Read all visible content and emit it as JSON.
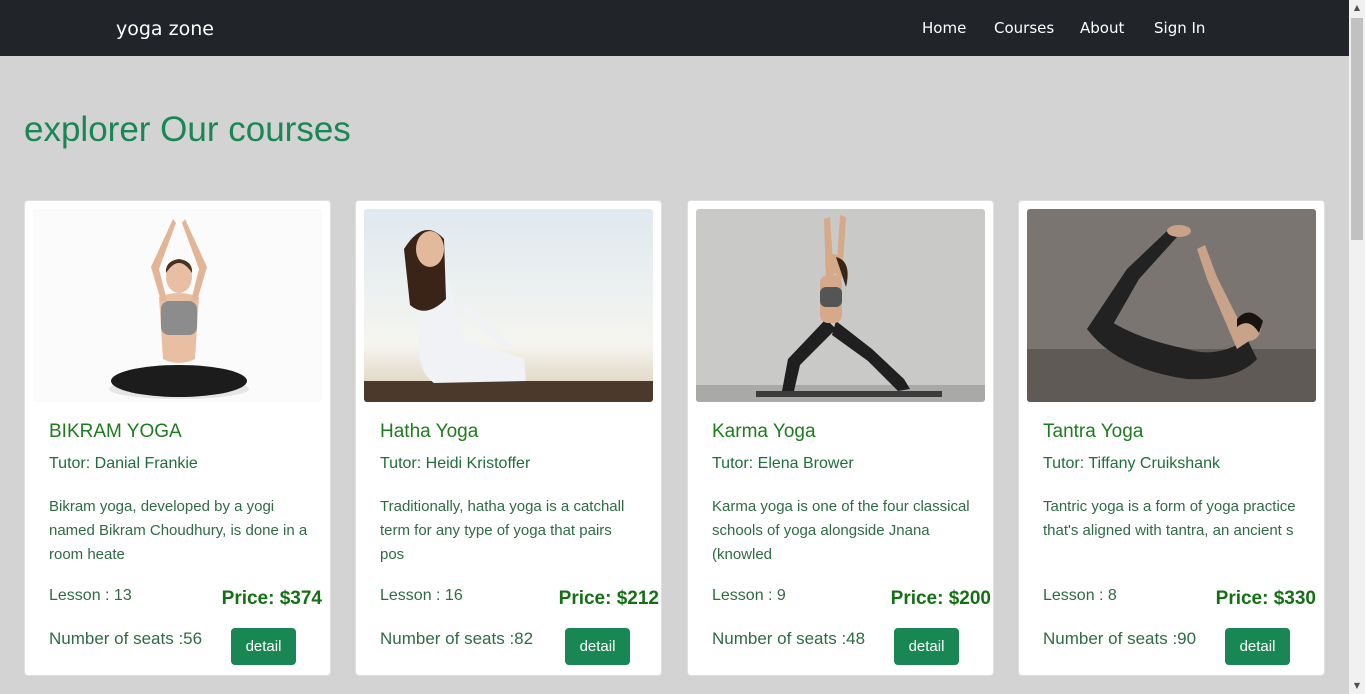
{
  "navbar": {
    "brand": "yoga zone",
    "links": [
      "Home",
      "Courses",
      "About",
      "Sign In"
    ]
  },
  "page": {
    "title": "explorer Our courses"
  },
  "courses": [
    {
      "title": "BIKRAM YOGA",
      "tutor": "Tutor: Danial Frankie",
      "description": "Bikram yoga, developed by a yogi named Bikram Choudhury, is done in a room heate",
      "lesson": "Lesson : 13",
      "price": "Price: $374",
      "seats": "Number of seats :56",
      "button": "detail",
      "image": "woman-meditating-lotus-icon"
    },
    {
      "title": "Hatha Yoga",
      "tutor": "Tutor: Heidi Kristoffer",
      "description": "Traditionally, hatha yoga is a catchall term for any type of yoga that pairs pos",
      "lesson": "Lesson : 16",
      "price": "Price: $212",
      "seats": "Number of seats :82",
      "button": "detail",
      "image": "woman-meditating-beach-icon"
    },
    {
      "title": "Karma Yoga",
      "tutor": "Tutor: Elena Brower",
      "description": "Karma yoga is one of the four classical schools of yoga alongside Jnana (knowled",
      "lesson": "Lesson : 9",
      "price": "Price: $200",
      "seats": "Number of seats :48",
      "button": "detail",
      "image": "warrior-pose-icon"
    },
    {
      "title": "Tantra Yoga",
      "tutor": "Tutor: Tiffany Cruikshank",
      "description": "Tantric yoga is a form of yoga practice that's aligned with tantra, an ancient s",
      "lesson": "Lesson : 8",
      "price": "Price: $330",
      "seats": "Number of seats :90",
      "button": "detail",
      "image": "bow-pose-icon"
    }
  ],
  "colors": {
    "navbar_bg": "#212529",
    "page_bg": "#d3d3d3",
    "accent_green": "#198754",
    "title_green": "#1e7b1e"
  }
}
